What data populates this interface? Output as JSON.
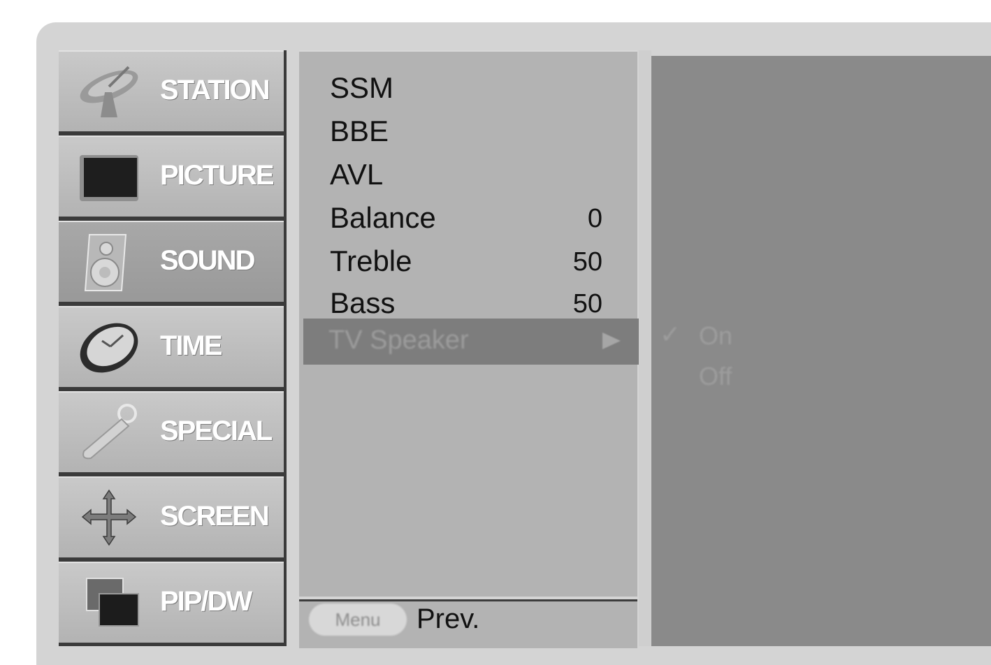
{
  "categories": [
    {
      "label": "STATION",
      "icon": "satellite-dish-icon"
    },
    {
      "label": "PICTURE",
      "icon": "tv-screen-icon"
    },
    {
      "label": "SOUND",
      "icon": "speaker-icon",
      "active": true
    },
    {
      "label": "TIME",
      "icon": "clock-icon"
    },
    {
      "label": "SPECIAL",
      "icon": "remote-key-icon"
    },
    {
      "label": "SCREEN",
      "icon": "move-arrows-icon"
    },
    {
      "label": "PIP/DW",
      "icon": "pip-windows-icon"
    }
  ],
  "sound_menu": {
    "items": [
      {
        "label": "SSM",
        "value": ""
      },
      {
        "label": "BBE",
        "value": ""
      },
      {
        "label": "AVL",
        "value": ""
      },
      {
        "label": "Balance",
        "value": "0"
      },
      {
        "label": "Treble",
        "value": "50"
      },
      {
        "label": "Bass",
        "value": "50"
      }
    ],
    "selected": {
      "label": "TV Speaker"
    }
  },
  "submenu": {
    "options": [
      {
        "label": "On",
        "checked": true
      },
      {
        "label": "Off",
        "checked": false
      }
    ]
  },
  "footer": {
    "menu_button_label": "Menu",
    "prev_label": "Prev."
  },
  "colors": {
    "background": "#d4d4d4",
    "highlight": "#7d7d7d",
    "panel": "#b3b3b3",
    "right_panel": "#8a8a8a"
  }
}
